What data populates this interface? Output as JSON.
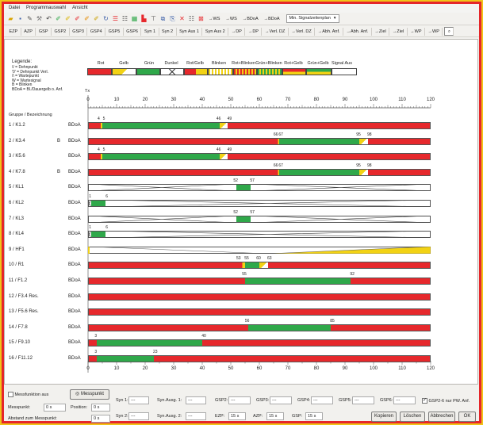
{
  "menu": [
    "Datei",
    "Programmauswahl",
    "Ansicht"
  ],
  "toolbar1": {
    "texts": [
      "→WS",
      "→WS",
      "→BDoA",
      "→BDoA"
    ],
    "select": "Min. Signalzeitenplan"
  },
  "toolbar2": [
    "EZP",
    "AZP",
    "GSP",
    "GSP2",
    "GSP3",
    "GSP4",
    "GSP5",
    "GSP6",
    "Syn 1",
    "Syn 2",
    "Syn Aus 1",
    "Syn Aus 2",
    "→DP",
    "→DP",
    "→Verl. DZ",
    "→Verl. DZ",
    "→Abh. Anf.",
    "→Abh. Anf.",
    "→Ziel",
    "→Ziel",
    "→WP",
    "→WP"
  ],
  "legend": {
    "title": "Legende:",
    "lines": [
      "\\/ = Dehnpunkt",
      "'0' = Dehnpunkt Verl.",
      "/\\ = Wartepunkt",
      "W = Wartesignal",
      "B = Blinken",
      "BDoA = Bl./Dauergelb o. Anf."
    ],
    "columns": [
      "Rot",
      "Gelb",
      "Grün",
      "Dunkel",
      "Rot/Gelb",
      "Blinken",
      "Rot+Blinken",
      "Grün+Blinken",
      "Rot+Gelb",
      "Grün+Gelb",
      "Signal Aus"
    ]
  },
  "axis": {
    "unit": "Tx",
    "ticks": [
      "0",
      "10",
      "20",
      "30",
      "40",
      "50",
      "60",
      "70",
      "80",
      "90",
      "100",
      "110",
      "120"
    ],
    "group_header": "Gruppe / Bezeichnung"
  },
  "rows": [
    {
      "label": "1 / K1.2",
      "b": "",
      "mode": "BDoA",
      "type": "rg",
      "green": [
        5,
        46
      ],
      "marks": [
        "4",
        "5",
        "46",
        "49"
      ],
      "markpos": [
        4,
        5,
        46,
        49
      ]
    },
    {
      "label": "2 / K3.4",
      "b": "B",
      "mode": "BDoA",
      "type": "rg",
      "green": [
        67,
        95
      ],
      "marks": [
        "66",
        "67",
        "95",
        "98"
      ],
      "markpos": [
        66,
        67,
        95,
        98
      ]
    },
    {
      "label": "3 / K5.6",
      "b": "",
      "mode": "BDoA",
      "type": "rg",
      "green": [
        5,
        46
      ],
      "marks": [
        "4",
        "5",
        "46",
        "49"
      ],
      "markpos": [
        4,
        5,
        46,
        49
      ]
    },
    {
      "label": "4 / K7.8",
      "b": "B",
      "mode": "BDoA",
      "type": "rg",
      "green": [
        67,
        95
      ],
      "marks": [
        "66",
        "67",
        "95",
        "98"
      ],
      "markpos": [
        66,
        67,
        95,
        98
      ]
    },
    {
      "label": "5 / KL1",
      "b": "",
      "mode": "BDoA",
      "type": "dg",
      "green": [
        52,
        57
      ],
      "marks": [
        "52",
        "57"
      ],
      "markpos": [
        52,
        57
      ]
    },
    {
      "label": "6 / KL2",
      "b": "",
      "mode": "BDoA",
      "type": "dg",
      "green": [
        1,
        6
      ],
      "marks": [
        "1",
        "6"
      ],
      "markpos": [
        1,
        6
      ]
    },
    {
      "label": "7 / KL3",
      "b": "",
      "mode": "BDoA",
      "type": "dg",
      "green": [
        52,
        57
      ],
      "marks": [
        "52",
        "57"
      ],
      "markpos": [
        52,
        57
      ]
    },
    {
      "label": "8 / KL4",
      "b": "",
      "mode": "BDoA",
      "type": "dg",
      "green": [
        1,
        6
      ],
      "marks": [
        "1",
        "6"
      ],
      "markpos": [
        1,
        6
      ]
    },
    {
      "label": "9 / HF1",
      "b": "",
      "mode": "BDoA",
      "type": "hf",
      "green": [],
      "marks": [],
      "markpos": []
    },
    {
      "label": "10 / R1",
      "b": "",
      "mode": "BDoA",
      "type": "rg",
      "green": [
        55,
        60
      ],
      "marks": [
        "53",
        "55",
        "60",
        "63"
      ],
      "markpos": [
        53,
        55,
        60,
        63
      ]
    },
    {
      "label": "11 / F1.2",
      "b": "",
      "mode": "BDoA",
      "type": "rg",
      "green": [
        55,
        92
      ],
      "marks": [
        "55",
        "92"
      ],
      "markpos": [
        55,
        92
      ]
    },
    {
      "label": "12 / F3.4 Res.",
      "b": "",
      "mode": "BDoA",
      "type": "rg",
      "green": [],
      "marks": [],
      "markpos": []
    },
    {
      "label": "13 / F5.6 Res.",
      "b": "",
      "mode": "BDoA",
      "type": "rg",
      "green": [],
      "marks": [],
      "markpos": []
    },
    {
      "label": "14 / F7.8",
      "b": "",
      "mode": "BDoA",
      "type": "rg",
      "green": [
        56,
        85
      ],
      "marks": [
        "56",
        "85"
      ],
      "markpos": [
        56,
        85
      ]
    },
    {
      "label": "15 / F9.10",
      "b": "",
      "mode": "BDoA",
      "type": "rg",
      "green": [
        3,
        40
      ],
      "marks": [
        "3",
        "40"
      ],
      "markpos": [
        3,
        40
      ]
    },
    {
      "label": "16 / F11.12",
      "b": "",
      "mode": "BDoA",
      "type": "rg",
      "green": [
        3,
        23
      ],
      "marks": [
        "3",
        "23"
      ],
      "markpos": [
        3,
        23
      ]
    }
  ],
  "bottom": {
    "messfunktion": "Messfunktion aus",
    "messpunkt_btn": "Messpunkt",
    "messpunkt_label": "Messpunkt:",
    "messpunkt_val": "0 s",
    "position_label": "Position:",
    "position_val": "0 s",
    "abstand_label": "Abstand zum Messpunkt:",
    "abstand_val": "0 s",
    "syn1": "Syn 1:",
    "syn1_val": "---",
    "synaus1": "Syn.Ausg. 1:",
    "synaus1_val": "---",
    "syn2": "Syn 2:",
    "syn2_val": "---",
    "synaus2": "Syn.Ausg. 2:",
    "synaus2_val": "---",
    "gsp2": "GSP2:",
    "gsp2_val": "---",
    "gsp3": "GSP3:",
    "gsp3_val": "---",
    "gsp4": "GSP4:",
    "gsp4_val": "---",
    "gsp5": "GSP5:",
    "gsp5_val": "---",
    "gsp6": "GSP6:",
    "gsp6_val": "---",
    "gsp26": "GSP2-6 nur PW. Anf.",
    "ezp": "EZP:",
    "ezp_val": "15 s",
    "azp": "AZP:",
    "azp_val": "15 s",
    "gsp": "GSP:",
    "gsp_val": "15 s",
    "kopieren": "Kopieren",
    "loeschen": "Löschen",
    "abbrechen": "Abbrechen",
    "ok": "OK"
  },
  "colors": {
    "red": "#e6282c",
    "green": "#2fa84a",
    "yellow": "#f2d214",
    "frame": "#e5262a"
  }
}
